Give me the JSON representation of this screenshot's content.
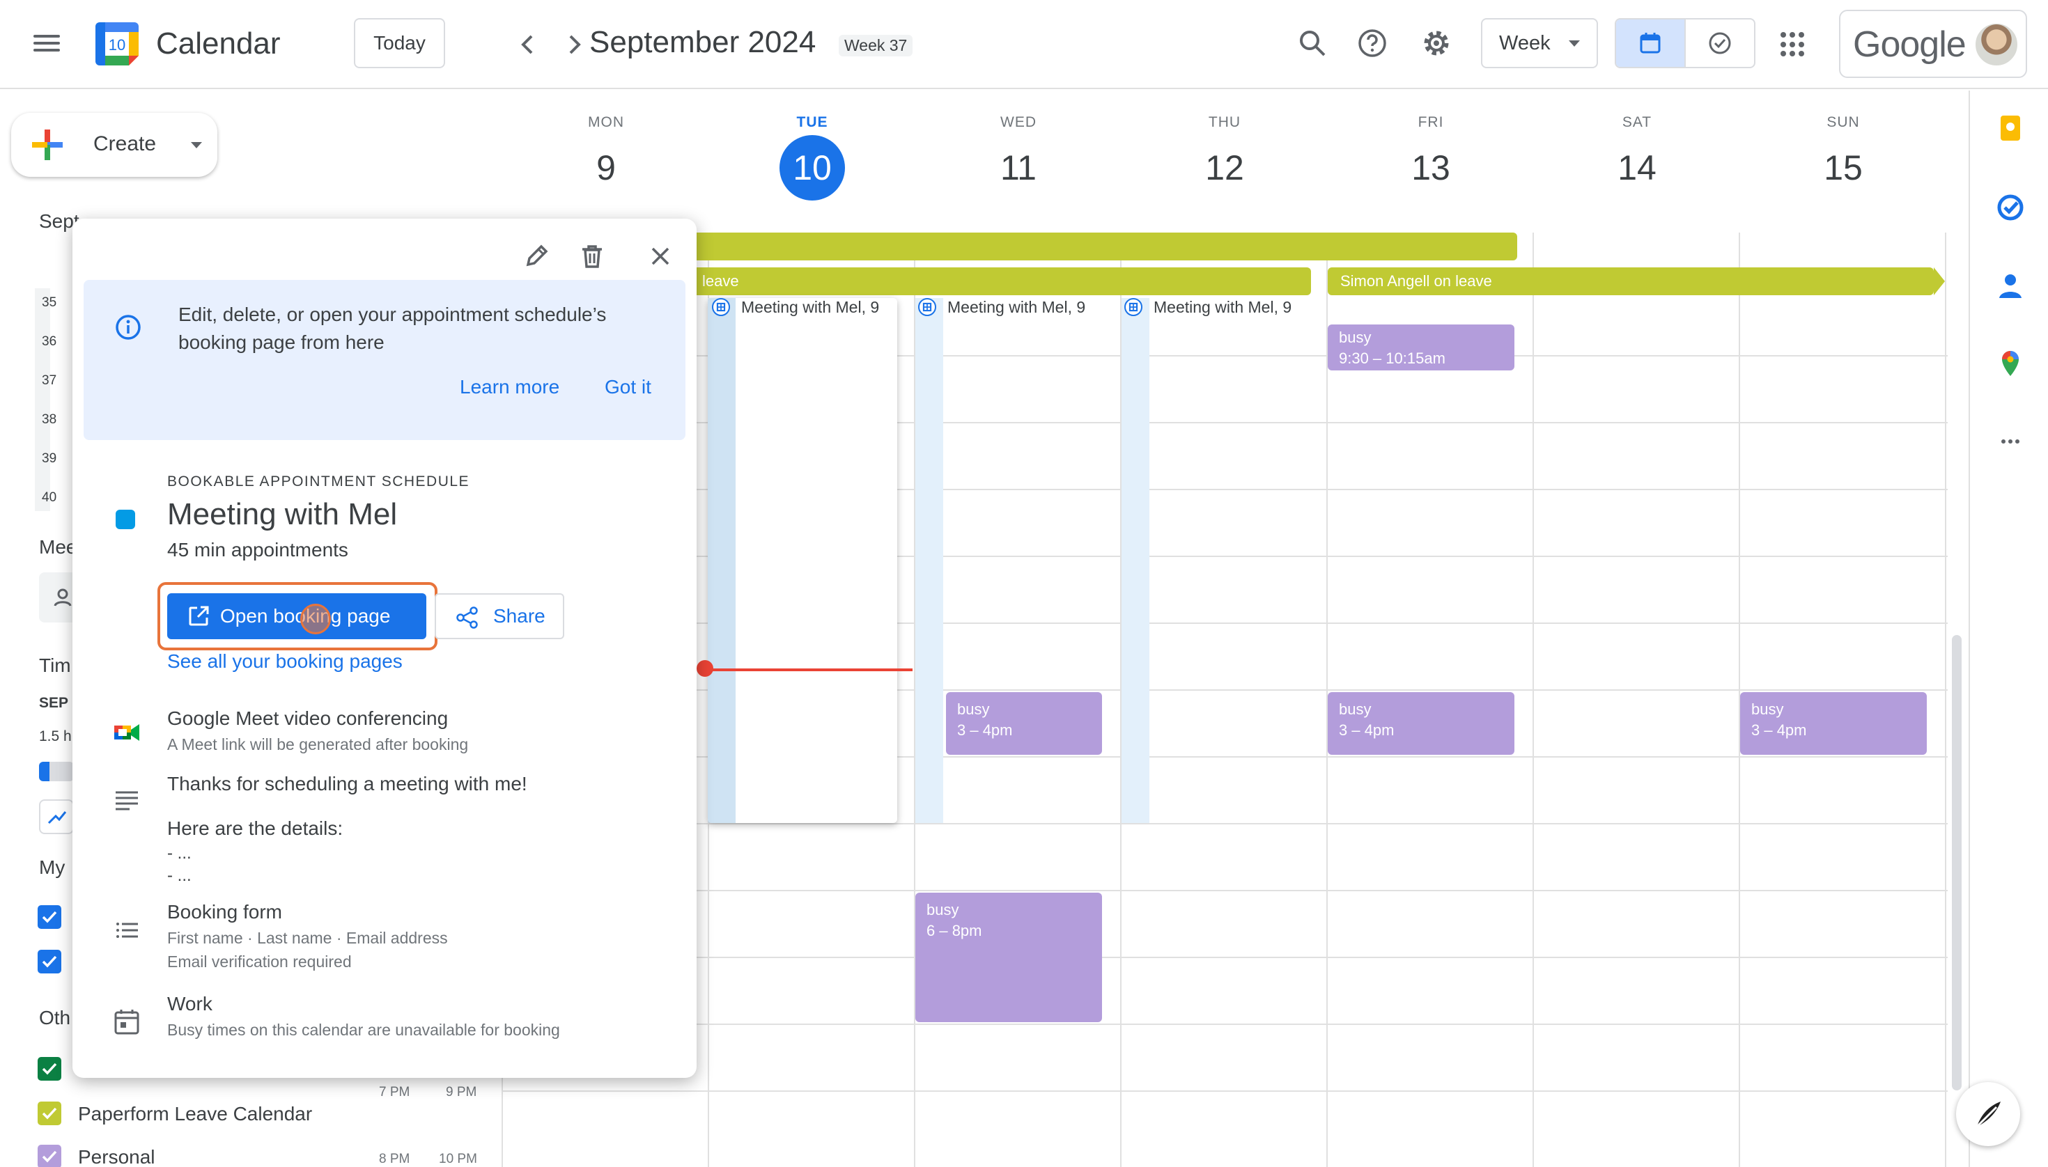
{
  "header": {
    "app_title": "Calendar",
    "logo_day": "10",
    "today_label": "Today",
    "month_title": "September 2024",
    "week_badge": "Week 37",
    "view_select": "Week",
    "google_word": "Google"
  },
  "sidebar": {
    "create_label": "Create",
    "mini_month": "Sept",
    "week_numbers": [
      "35",
      "36",
      "37",
      "38",
      "39",
      "40"
    ],
    "section_meet": "Mee",
    "section_time": "Tim",
    "sep_label": "SEP",
    "duration": "1.5 h",
    "my_calendars": "My",
    "other_calendars": "Oth",
    "other_items": [
      {
        "label": "Paperform Leave Calendar",
        "color": "#c0ca33"
      },
      {
        "label": "Personal",
        "color": "#b39ddb"
      }
    ],
    "times": {
      "t1a": "7 PM",
      "t1b": "9 PM",
      "t2a": "8 PM",
      "t2b": "10 PM"
    }
  },
  "days": [
    {
      "name": "MON",
      "num": "9"
    },
    {
      "name": "TUE",
      "num": "10",
      "today": true
    },
    {
      "name": "WED",
      "num": "11"
    },
    {
      "name": "THU",
      "num": "12"
    },
    {
      "name": "FRI",
      "num": "13"
    },
    {
      "name": "SAT",
      "num": "14"
    },
    {
      "name": "SUN",
      "num": "15"
    }
  ],
  "events": {
    "leave_partial": "leave",
    "leave_simon": "Simon Angell on leave",
    "appt_label": "Meeting with Mel, 9",
    "busy_label": "busy",
    "busy_fri_morning": "9:30 – 10:15am",
    "busy_wed": "3 – 4pm",
    "busy_fri": "3 – 4pm",
    "busy_sun": "3 – 4pm",
    "busy_wed_evening": "6 – 8pm"
  },
  "popup": {
    "info_text": "Edit, delete, or open your appointment schedule’s booking page from here",
    "learn_more": "Learn more",
    "got_it": "Got it",
    "eyebrow": "BOOKABLE APPOINTMENT SCHEDULE",
    "title": "Meeting with Mel",
    "subtitle": "45 min appointments",
    "open_booking": "Open booking page",
    "share": "Share",
    "see_all": "See all your booking pages",
    "meet_title": "Google Meet video conferencing",
    "meet_sub": "A Meet link will be generated after booking",
    "desc_line1": "Thanks for scheduling a meeting with me!",
    "desc_line2": "Here are the details:",
    "desc_line3": "- ...",
    "desc_line4": "- ...",
    "form_title": "Booking form",
    "form_sub1": "First name · Last name · Email address",
    "form_sub2": "Email verification required",
    "cal_title": "Work",
    "cal_sub": "Busy times on this calendar are unavailable for booking"
  },
  "colors": {
    "accent": "#1a73e8",
    "leave": "#c0ca33",
    "busy": "#b39ddb",
    "focus": "#e8743b"
  }
}
